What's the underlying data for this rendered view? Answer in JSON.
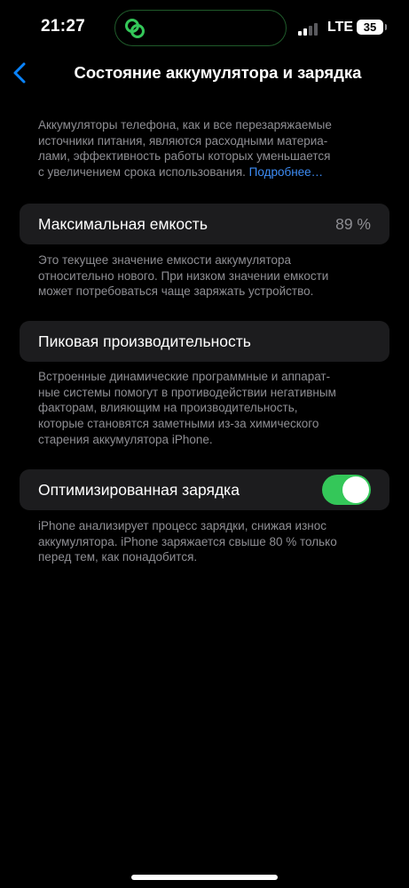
{
  "status_bar": {
    "time": "21:27",
    "network": "LTE",
    "battery_level": "35",
    "island_icon": "link-icon"
  },
  "nav": {
    "back_icon": "chevron-left-icon",
    "title": "Состояние аккумулятора и зарядка"
  },
  "intro": {
    "text_lines": [
      "Аккумуляторы телефона, как и все перезаряжаемые",
      "источники питания, являются расходными материа-",
      "лами, эффективность работы которых уменьшается",
      "с увеличением срока использования. "
    ],
    "link": "Подробнее…"
  },
  "max_capacity": {
    "label": "Максимальная емкость",
    "value": "89 %",
    "footer_lines": [
      "Это текущее значение емкости аккумулятора",
      "относительно нового. При низком значении емкости",
      "может потребоваться чаще заряжать устройство."
    ]
  },
  "peak_performance": {
    "label": "Пиковая производительность",
    "footer_lines": [
      "Встроенные динамические программные и аппарат-",
      "ные системы помогут в противодействии негативным",
      "факторам, влияющим на производительность,",
      "которые становятся заметными из-за химического",
      "старения аккумулятора iPhone."
    ]
  },
  "optimized_charging": {
    "label": "Оптимизированная зарядка",
    "enabled": true,
    "toggle_color": "#34c759",
    "footer_lines": [
      "iPhone анализирует процесс зарядки, снижая износ",
      "аккумулятора. iPhone заряжается свыше 80 % только",
      "перед тем, как понадобится."
    ]
  },
  "colors": {
    "background": "#000000",
    "cell": "#1c1c1e",
    "secondary_text": "#8e8e93",
    "link": "#3d8cf5",
    "accent_blue": "#0a84ff"
  }
}
